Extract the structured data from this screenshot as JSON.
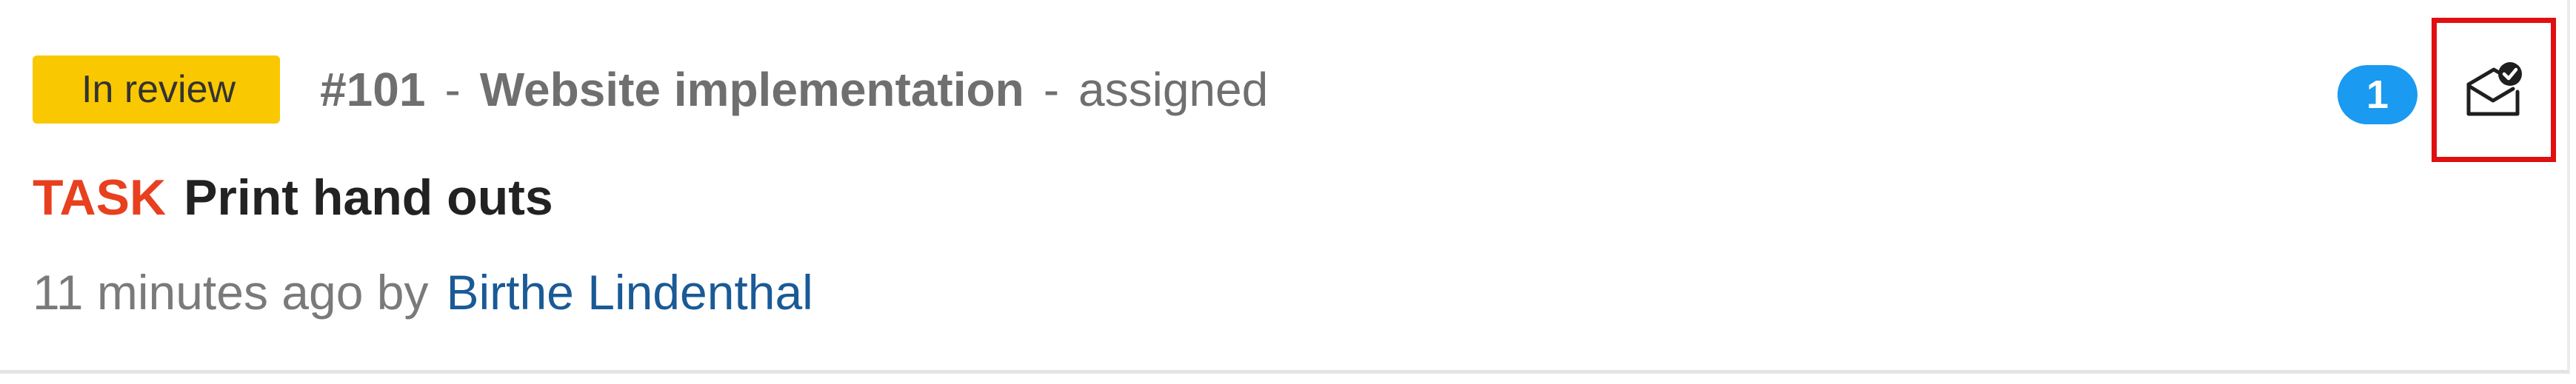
{
  "notification": {
    "status": "In review",
    "context": {
      "id": "#101",
      "separator": "-",
      "project": "Website implementation",
      "reason": "assigned"
    },
    "work_package": {
      "type": "TASK",
      "subject": "Print hand outs"
    },
    "meta": {
      "time_ago": "11 minutes ago by",
      "author": "Birthe Lindenthal"
    },
    "count": "1",
    "mark_read_icon": "envelope-open-check-icon"
  },
  "colors": {
    "status_badge": "#f9c800",
    "type_label": "#e8401f",
    "author_link": "#1a5a96",
    "count_badge": "#1a9af0",
    "highlight_border": "#e01010"
  }
}
